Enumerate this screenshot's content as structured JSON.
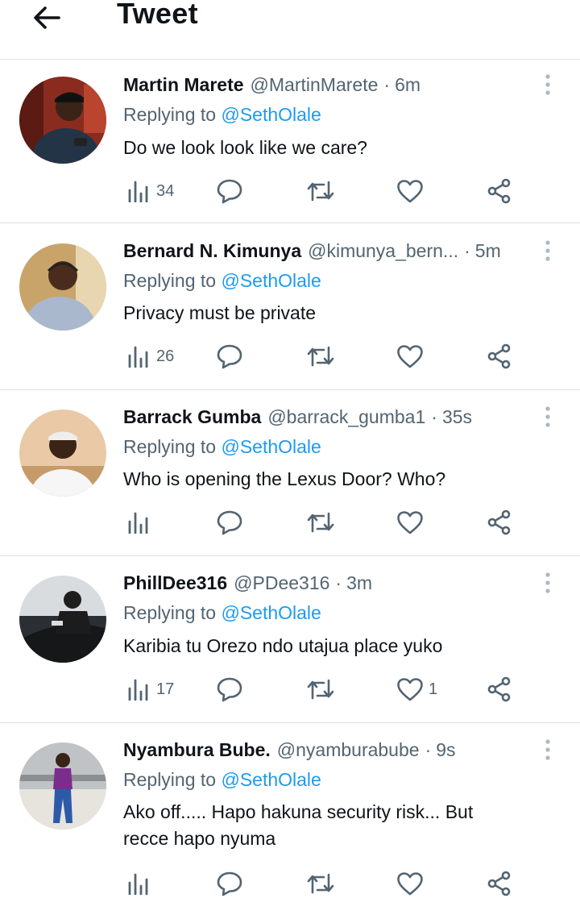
{
  "header": {
    "title": "Tweet"
  },
  "colors": {
    "accent": "#1d9bf0",
    "secondary_text": "#536471",
    "primary_text": "#0f1419",
    "divider": "#dcdfe3"
  },
  "icons": {
    "back": "arrow-left-icon",
    "more": "more-vertical-icon",
    "views": "views-icon",
    "reply": "reply-icon",
    "retweet": "retweet-icon",
    "like": "like-icon",
    "share": "share-icon"
  },
  "replies": [
    {
      "author": "Martin Marete",
      "handle": "@MartinMarete",
      "time": "6m",
      "replying_label": "Replying to",
      "replying_to": "@SethOlale",
      "text": "Do we look look like we care?",
      "views": "34",
      "likes": ""
    },
    {
      "author": "Bernard N. Kimunya",
      "handle": "@kimunya_bern...",
      "time": "5m",
      "replying_label": "Replying to",
      "replying_to": "@SethOlale",
      "text": "Privacy must be private",
      "views": "26",
      "likes": ""
    },
    {
      "author": "Barrack Gumba",
      "handle": "@barrack_gumba1",
      "time": "35s",
      "replying_label": "Replying to",
      "replying_to": "@SethOlale",
      "text": "Who is opening the Lexus Door? Who?",
      "views": "",
      "likes": ""
    },
    {
      "author": "PhillDee316",
      "handle": "@PDee316",
      "time": "3m",
      "replying_label": "Replying to",
      "replying_to": "@SethOlale",
      "text": "Karibia tu Orezo ndo utajua place yuko",
      "views": "17",
      "likes": "1"
    },
    {
      "author": "Nyambura Bube.",
      "handle": "@nyamburabube",
      "time": "9s",
      "replying_label": "Replying to",
      "replying_to": "@SethOlale",
      "text_line1": "Ako off..... Hapo hakuna security risk... But",
      "text_line2": "recce hapo nyuma",
      "views": "",
      "likes": ""
    }
  ]
}
